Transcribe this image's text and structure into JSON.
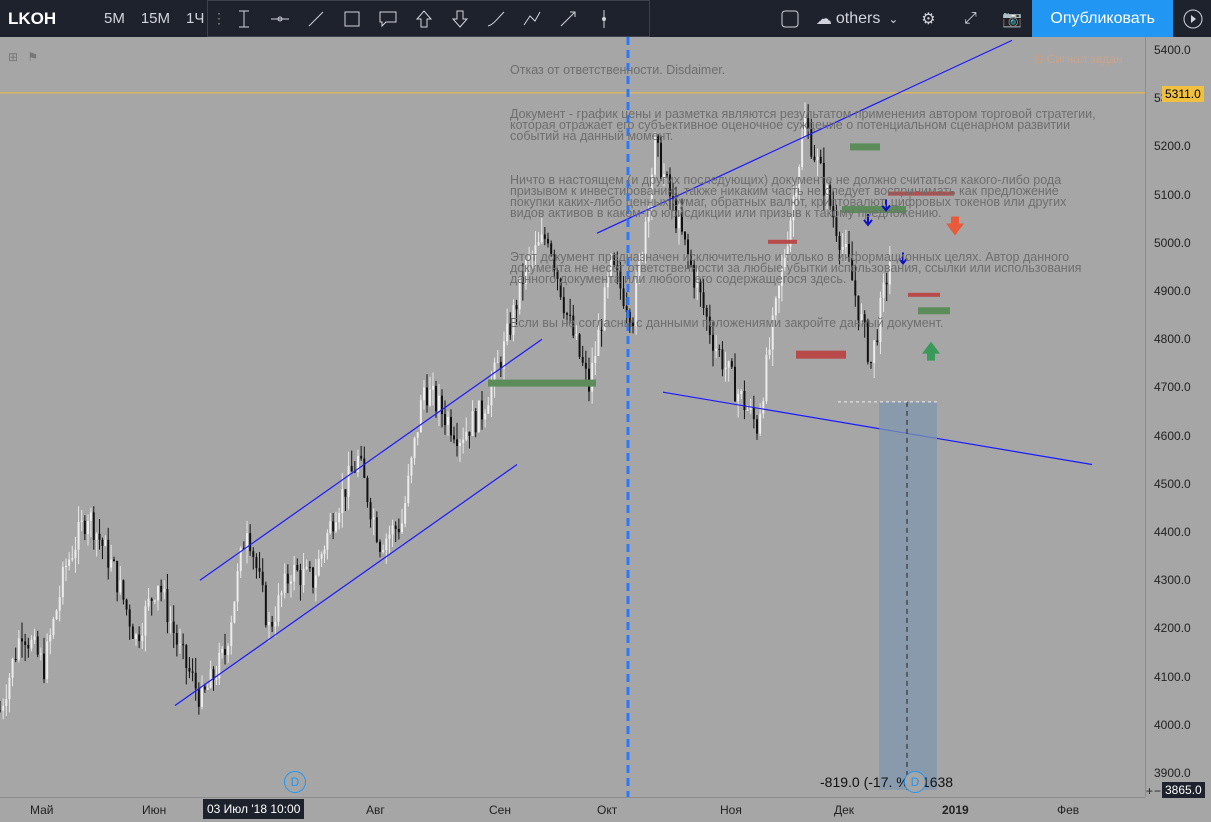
{
  "topbar": {
    "symbol": "LKOH",
    "timeframes": [
      "5M",
      "15M",
      "1Ч"
    ],
    "template_name": "others",
    "publish_label": "Опубликовать"
  },
  "disclaimer": [
    "Отказ от ответственности. Disdaimer.",
    "Документ - график цены и разметка являются результатом применения автором торговой стратегии, которая отражает его субъективное оценочное суждение о потенциальном сценарном развитии событий на данный момент.",
    "Ничто в настоящем (и других последующих) документе не должно считаться какого-либо рода призывом к инвестированию, также никаким часть не следует воспринимать как предложение покупки каких-либо ценных бумаг, обратных валют, криптовалют, цифровых токенов или других видов активов в каком-то юрисдикции или призыв к такому предложению.",
    "Этот документ предназначен исключительно и только в информационных целях. Автор данного документа не несет ответственности за любые убытки использования, ссылки или использования данного документа или любого его содержащегося здесь.",
    "Если вы не согласны с данными положениями закройте данный документ."
  ],
  "alert_label": "Сигнал задан",
  "current_price": "5311.0",
  "last_price_tag": "3865.0",
  "measure_label": "-819.0 (-17.  %) -1638",
  "date_tag": "03 Июл '18   10:00",
  "time_labels": [
    "Май",
    "Июн",
    "Авг",
    "Сен",
    "Окт",
    "Ноя",
    "Дек",
    "2019",
    "Фев"
  ],
  "colors": {
    "background": "#a6a6a6",
    "channel_line": "#1a1aff",
    "vertical_dashed": "#2979ff",
    "support_green": "#5b8c5a",
    "resist_red": "#b84a4a",
    "price_line": "#f0c040",
    "measure_box": "#7f96ad"
  },
  "chart_data": {
    "type": "candlestick",
    "symbol": "LKOH",
    "ylim": [
      3865,
      5430
    ],
    "yticks": [
      3900,
      4000,
      4100,
      4200,
      4300,
      4400,
      4500,
      4600,
      4700,
      4800,
      4900,
      5000,
      5100,
      5200,
      5300,
      5400
    ],
    "x_categories": [
      "Май",
      "Июн",
      "Июл",
      "Авг",
      "Сен",
      "Окт",
      "Ноя",
      "Дек",
      "2019",
      "Фев"
    ],
    "close_path": [
      [
        "Май",
        4030
      ],
      [
        "Май",
        4200
      ],
      [
        "Май",
        4120
      ],
      [
        "Май",
        4330
      ],
      [
        "Май",
        4440
      ],
      [
        "Июн",
        4320
      ],
      [
        "Июн",
        4180
      ],
      [
        "Июн",
        4300
      ],
      [
        "Июн",
        4150
      ],
      [
        "Июн",
        4050
      ],
      [
        "Июл",
        4150
      ],
      [
        "Июл",
        4420
      ],
      [
        "Июл",
        4200
      ],
      [
        "Июл",
        4320
      ],
      [
        "Июл",
        4300
      ],
      [
        "Авг",
        4450
      ],
      [
        "Авг",
        4550
      ],
      [
        "Авг",
        4380
      ],
      [
        "Авг",
        4420
      ],
      [
        "Авг",
        4700
      ],
      [
        "Сен",
        4600
      ],
      [
        "Сен",
        4650
      ],
      [
        "Сен",
        4780
      ],
      [
        "Сен",
        4950
      ],
      [
        "Сен",
        5020
      ],
      [
        "Окт",
        4850
      ],
      [
        "Окт",
        4700
      ],
      [
        "Окт",
        4950
      ],
      [
        "Окт",
        4850
      ],
      [
        "Окт",
        5200
      ],
      [
        "Ноя",
        4950
      ],
      [
        "Ноя",
        4800
      ],
      [
        "Ноя",
        4700
      ],
      [
        "Ноя",
        4620
      ],
      [
        "Ноя",
        4900
      ],
      [
        "Дек",
        5250
      ],
      [
        "Дек",
        5100
      ],
      [
        "Дек",
        4950
      ],
      [
        "Дек",
        4750
      ],
      [
        "Дек",
        5000
      ]
    ],
    "trendlines": [
      {
        "from": [
          "Июн",
          4300
        ],
        "to": [
          "Авг",
          4800
        ]
      },
      {
        "from": [
          "Июн",
          4040
        ],
        "to": [
          "Сен",
          4540
        ]
      },
      {
        "from": [
          "Окт",
          5020
        ],
        "to": [
          "2019",
          5420
        ]
      },
      {
        "from": [
          "Окт",
          4690
        ],
        "to": [
          "Фев",
          4540
        ]
      }
    ],
    "support_zones": [
      4710,
      5070,
      5200,
      4860
    ],
    "resistance_zones": [
      4770,
      5000,
      5100,
      4890
    ]
  }
}
